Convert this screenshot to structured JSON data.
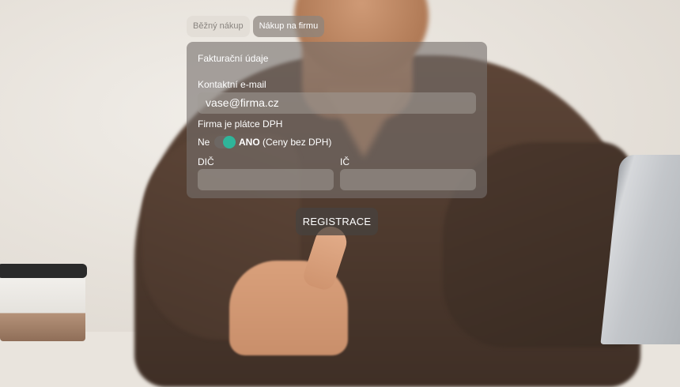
{
  "tabs": [
    {
      "label": "Běžný nákup",
      "active": false
    },
    {
      "label": "Nákup na firmu",
      "active": true
    }
  ],
  "form": {
    "title": "Fakturační údaje",
    "email_label": "Kontaktní e-mail",
    "email_value": "vase@firma.cz",
    "vat_payer_label": "Firma je plátce DPH",
    "toggle_off_label": "Ne",
    "toggle_on_label": "ANO",
    "toggle_on_note": "(Ceny bez DPH)",
    "toggle_state": "on",
    "dic_label": "DIČ",
    "dic_value": "",
    "ic_label": "IČ",
    "ic_value": ""
  },
  "actions": {
    "register_label": "REGISTRACE"
  },
  "colors": {
    "toggle_accent": "#2fb59a",
    "panel": "#76706c",
    "button": "#464240"
  },
  "icons": {
    "toggle": "toggle-switch"
  }
}
